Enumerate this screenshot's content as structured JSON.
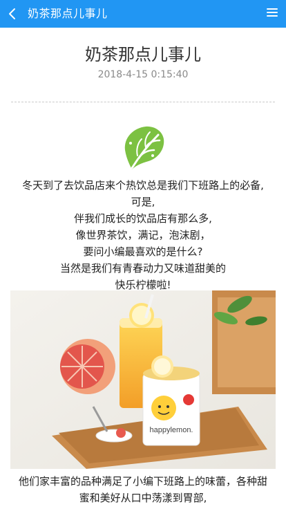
{
  "topbar": {
    "title": "奶茶那点儿事儿",
    "back_icon": "chevron-left-icon",
    "menu_icon": "hamburger-menu-icon",
    "background": "#2196f3"
  },
  "article": {
    "title": "奶茶那点儿事儿",
    "date": "2018-4-15 0:15:40"
  },
  "intro_lines": [
    "冬天到了去饮品店来个热饮总是我们下班路上的必备,",
    "可是,",
    "伴我们成长的饮品店有那么多,",
    "像世界茶饮，满记，泡沫剧，",
    "要问小编最喜欢的是什么?",
    "当然是我们有青春动力又味道甜美的",
    "快乐柠檬啦!"
  ],
  "hero_image": {
    "cup_brand": "happylemon."
  },
  "para2_lines": [
    "他们家丰富的品种满足了小编下班路上的味蕾，各种甜",
    "蜜和美好从口中荡漾到胃部,"
  ]
}
